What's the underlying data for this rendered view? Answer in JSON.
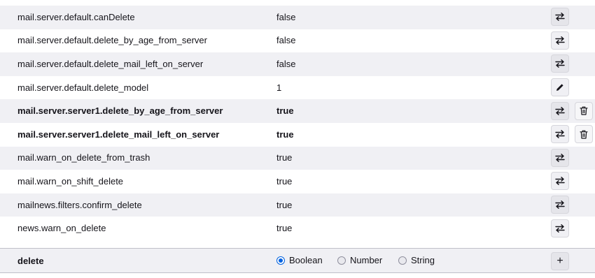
{
  "prefs": [
    {
      "name": "mail.server.default.canDelete",
      "value": "false",
      "modified": false,
      "action": "toggle",
      "action_icon": "toggle-arrows-icon"
    },
    {
      "name": "mail.server.default.delete_by_age_from_server",
      "value": "false",
      "modified": false,
      "action": "toggle",
      "action_icon": "toggle-arrows-icon"
    },
    {
      "name": "mail.server.default.delete_mail_left_on_server",
      "value": "false",
      "modified": false,
      "action": "toggle",
      "action_icon": "toggle-arrows-icon"
    },
    {
      "name": "mail.server.default.delete_model",
      "value": "1",
      "modified": false,
      "action": "edit",
      "action_icon": "pencil-icon"
    },
    {
      "name": "mail.server.server1.delete_by_age_from_server",
      "value": "true",
      "modified": true,
      "action": "toggle",
      "action_icon": "toggle-arrows-icon",
      "reset_icon": "trash-icon"
    },
    {
      "name": "mail.server.server1.delete_mail_left_on_server",
      "value": "true",
      "modified": true,
      "action": "toggle",
      "action_icon": "toggle-arrows-icon",
      "reset_icon": "trash-icon"
    },
    {
      "name": "mail.warn_on_delete_from_trash",
      "value": "true",
      "modified": false,
      "action": "toggle",
      "action_icon": "toggle-arrows-icon"
    },
    {
      "name": "mail.warn_on_shift_delete",
      "value": "true",
      "modified": false,
      "action": "toggle",
      "action_icon": "toggle-arrows-icon"
    },
    {
      "name": "mailnews.filters.confirm_delete",
      "value": "true",
      "modified": false,
      "action": "toggle",
      "action_icon": "toggle-arrows-icon"
    },
    {
      "name": "news.warn_on_delete",
      "value": "true",
      "modified": false,
      "action": "toggle",
      "action_icon": "toggle-arrows-icon"
    }
  ],
  "add_row": {
    "name": "delete",
    "types": [
      {
        "label": "Boolean",
        "checked": true
      },
      {
        "label": "Number",
        "checked": false
      },
      {
        "label": "String",
        "checked": false
      }
    ],
    "add_label": "+",
    "add_icon": "plus-icon"
  },
  "colors": {
    "row_alt": "#f0f0f4",
    "accent": "#0061e0"
  }
}
